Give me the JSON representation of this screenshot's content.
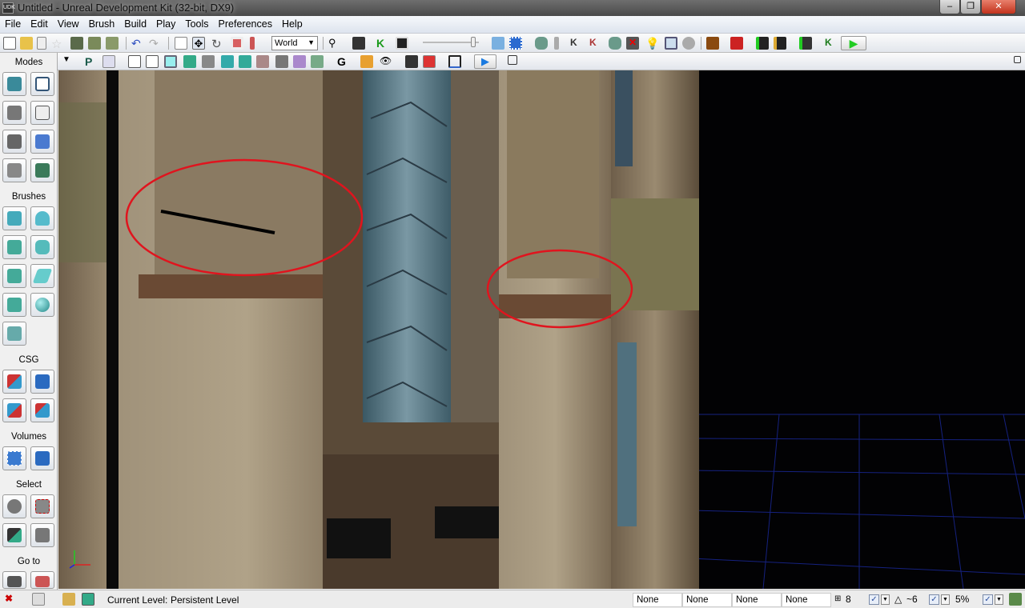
{
  "window": {
    "title": "Untitled - Unreal Development Kit (32-bit, DX9)",
    "logo": "UDK",
    "minimize": "–",
    "restore": "❐",
    "close": "✕"
  },
  "menu": [
    "File",
    "Edit",
    "View",
    "Brush",
    "Build",
    "Play",
    "Tools",
    "Preferences",
    "Help"
  ],
  "toolbar": {
    "coordinate_system": "World",
    "coordinate_arrow": "▼",
    "p_label": "P",
    "g_label": "G"
  },
  "modes_panel": {
    "title": "Modes",
    "sections": [
      "Brushes",
      "CSG",
      "Volumes",
      "Select",
      "Go to"
    ]
  },
  "status": {
    "current_level_label": "Current Level:",
    "current_level": "Persistent Level",
    "fields": [
      "None",
      "None",
      "None",
      "None"
    ],
    "grid": "8",
    "rotation": "~6",
    "scale": "5%"
  },
  "colors": {
    "annotation": "#e0141e",
    "grid": "#1e2fb4"
  }
}
